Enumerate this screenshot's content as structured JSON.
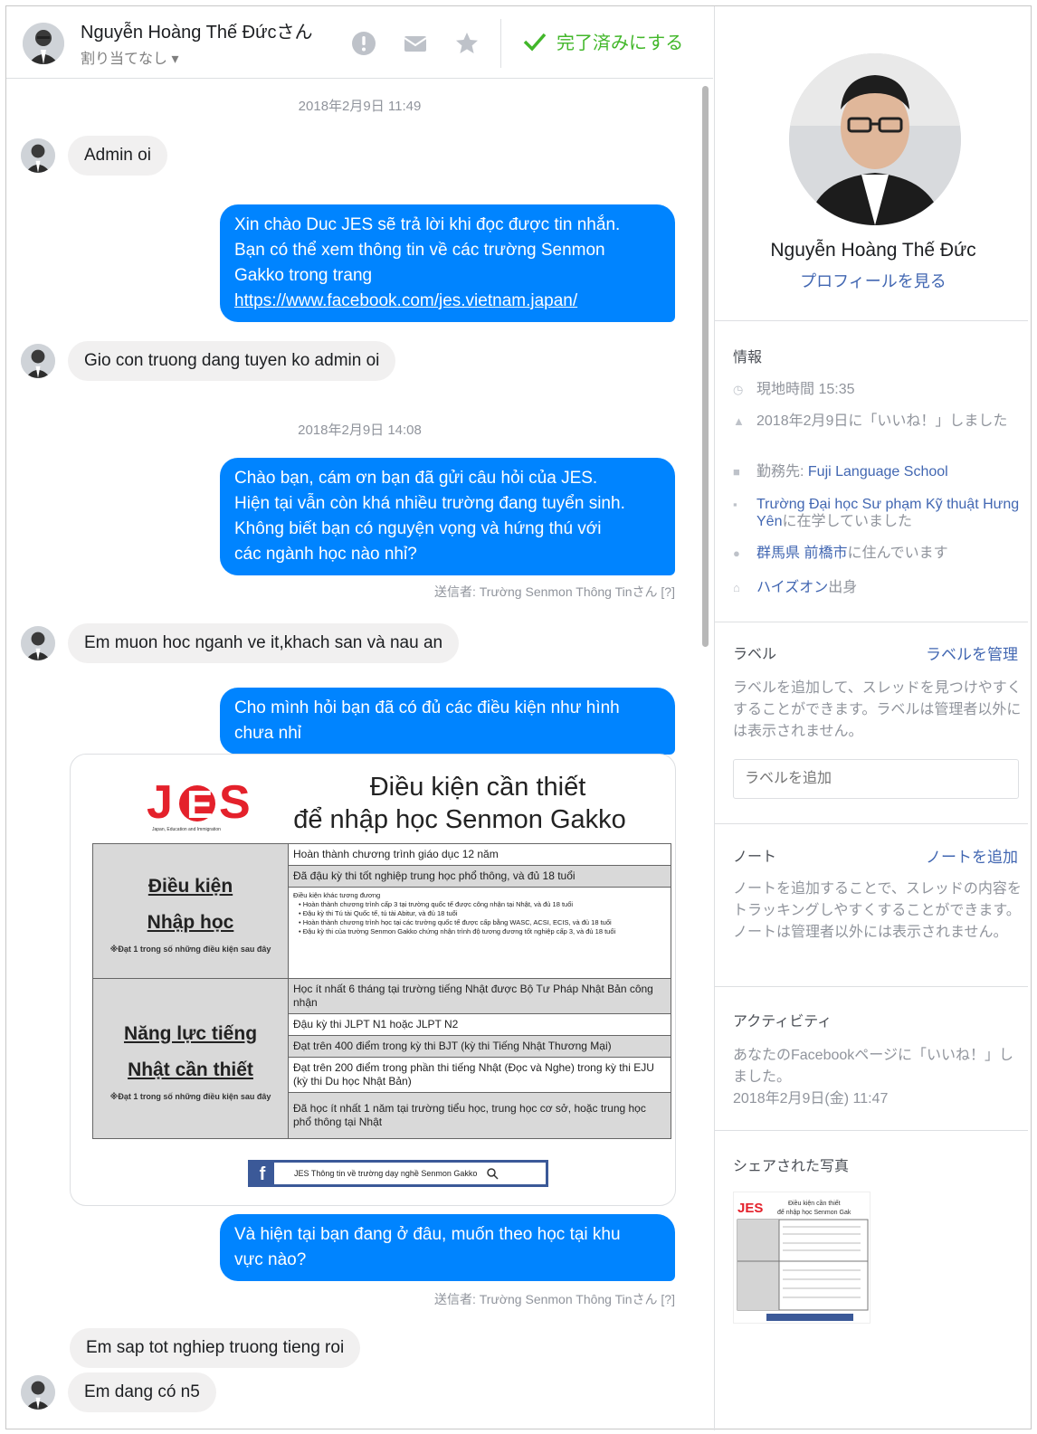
{
  "header": {
    "name": "Nguyễn Hoàng Thế Đứcさん",
    "assignment": "割り当てなし ▾",
    "done_label": "完了済みにする"
  },
  "messages": {
    "ts1": "2018年2月9日 11:49",
    "m1": "Admin oi",
    "r1": [
      "Xin chào Duc JES sẽ trả lời khi đọc được tin nhắn.",
      "Bạn có thể xem thông tin về các trường Senmon",
      "Gakko trong trang"
    ],
    "r1_link": "https://www.facebook.com/jes.vietnam.japan/",
    "m2": "Gio con truong dang tuyen ko admin oi",
    "ts2": "2018年2月9日 14:08",
    "r2": [
      "Chào bạn, cám ơn bạn đã gửi câu hỏi của JES.",
      "Hiện tại vẫn còn khá nhiều trường đang tuyển sinh.",
      "Không biết bạn có nguyện vọng và hứng thú với",
      "các ngành học nào nhỉ?"
    ],
    "sender1": "送信者: Trường Senmon Thông Tinさん [?]",
    "m3": "Em muon hoc nganh ve it,khach san và nau an",
    "r3": [
      "Cho mình hỏi bạn đã có đủ các điều kiện như hình",
      "chưa nhỉ"
    ],
    "r4": [
      "Và hiện tại bạn đang ở đâu, muốn theo học tại khu",
      "vực nào?"
    ],
    "sender2": "送信者: Trường Senmon Thông Tinさん [?]",
    "m4": "Em sap tot nghiep truong tieng roi",
    "m5": "Em dang có n5"
  },
  "image_card": {
    "logo_text": "JES",
    "logo_sub": "Japan, Education and Immigration",
    "title_line1": "Điều kiện cần thiết",
    "title_line2": "để nhập học Senmon Gakko",
    "sec1_label1": "Điều kiện",
    "sec1_label2": "Nhập học",
    "sec1_note": "※Đạt 1 trong số những điều kiện sau đây",
    "sec1_rows": [
      "Hoàn thành chương trình giáo dục 12 năm",
      "Đã đậu kỳ thi tốt nghiệp trung học phổ thông, và đủ 18 tuổi"
    ],
    "sec1_small": [
      "Điều kiện khác tương đương",
      "• Hoàn thành chương trình cấp 3 tại trường quốc tế được công nhận tại Nhật, và đủ 18 tuổi",
      "• Đậu kỳ thi Tú tài Quốc tế, tú tài Abitur, và đủ 18 tuổi",
      "• Hoàn thành chương trình học tại các trường quốc tế được cấp bằng WASC, ACSI, ECIS, và đủ 18 tuổi",
      "• Đậu kỳ thi của trường Senmon Gakko chứng nhận trình độ tương đương tốt nghiệp cấp 3, và đủ 18 tuổi"
    ],
    "sec2_label1": "Năng lực tiếng",
    "sec2_label2": "Nhật cần thiết",
    "sec2_note": "※Đạt 1 trong số những điều kiện sau đây",
    "sec2_rows": [
      "Học ít nhất 6 tháng tại trường tiếng Nhật được Bộ Tư Pháp Nhật Bản công nhận",
      "Đậu kỳ thi JLPT N1 hoặc JLPT N2",
      "Đạt trên 400 điểm trong kỳ thi BJT (kỳ thi Tiếng Nhật Thương Mại)",
      "Đạt trên 200 điểm trong phần thi tiếng Nhật (Đọc và Nghe) trong kỳ thi EJU (kỳ thi Du học Nhật Bản)",
      "Đã học ít nhất 1 năm tại trường tiểu học, trung học cơ sở, hoặc trung học phổ thông tại Nhật"
    ],
    "fb_icon": "f",
    "fb_text": "JES Thông tin về trường dạy nghề Senmon Gakko"
  },
  "profile": {
    "name": "Nguyễn Hoàng Thế Đức",
    "view_profile": "プロフィールを見る"
  },
  "info": {
    "title": "情報",
    "local_time": "現地時間 15:35",
    "liked": "2018年2月9日に「いいね！」しました",
    "work_prefix": "勤務先: ",
    "work_link": "Fuji Language School",
    "school_link": "Trường Đại học Sư phạm Kỹ thuật Hưng Yên",
    "school_suffix": "に在学していました",
    "live_link": "群馬県 前橋市",
    "live_suffix": "に住んでいます",
    "from_link": "ハイズオン",
    "from_suffix": "出身"
  },
  "labels": {
    "title": "ラベル",
    "manage": "ラベルを管理",
    "desc": "ラベルを追加して、スレッドを見つけやすくすることができます。ラベルは管理者以外には表示されません。",
    "input_placeholder": "ラベルを追加"
  },
  "notes": {
    "title": "ノート",
    "add": "ノートを追加",
    "desc": "ノートを追加することで、スレッドの内容をトラッキングしやすくすることができます。ノートは管理者以外には表示されません。"
  },
  "activity": {
    "title": "アクティビティ",
    "text": "あなたのFacebookページに「いいね！」しました。",
    "date": "2018年2月9日(金) 11:47"
  },
  "shared": {
    "title": "シェアされた写真",
    "thumb_logo": "JES",
    "thumb_title1": "Điều kiện cần thiết",
    "thumb_title2": "để nhập học Senmon Gak"
  },
  "colors": {
    "accent": "#0084ff",
    "link": "#4267b2",
    "done": "#42b72a"
  },
  "icons": [
    "alert-icon",
    "envelope-icon",
    "star-icon",
    "check-icon",
    "clock-icon",
    "thumbs-up-icon",
    "briefcase-icon",
    "graduation-cap-icon",
    "location-pin-icon",
    "home-icon"
  ]
}
